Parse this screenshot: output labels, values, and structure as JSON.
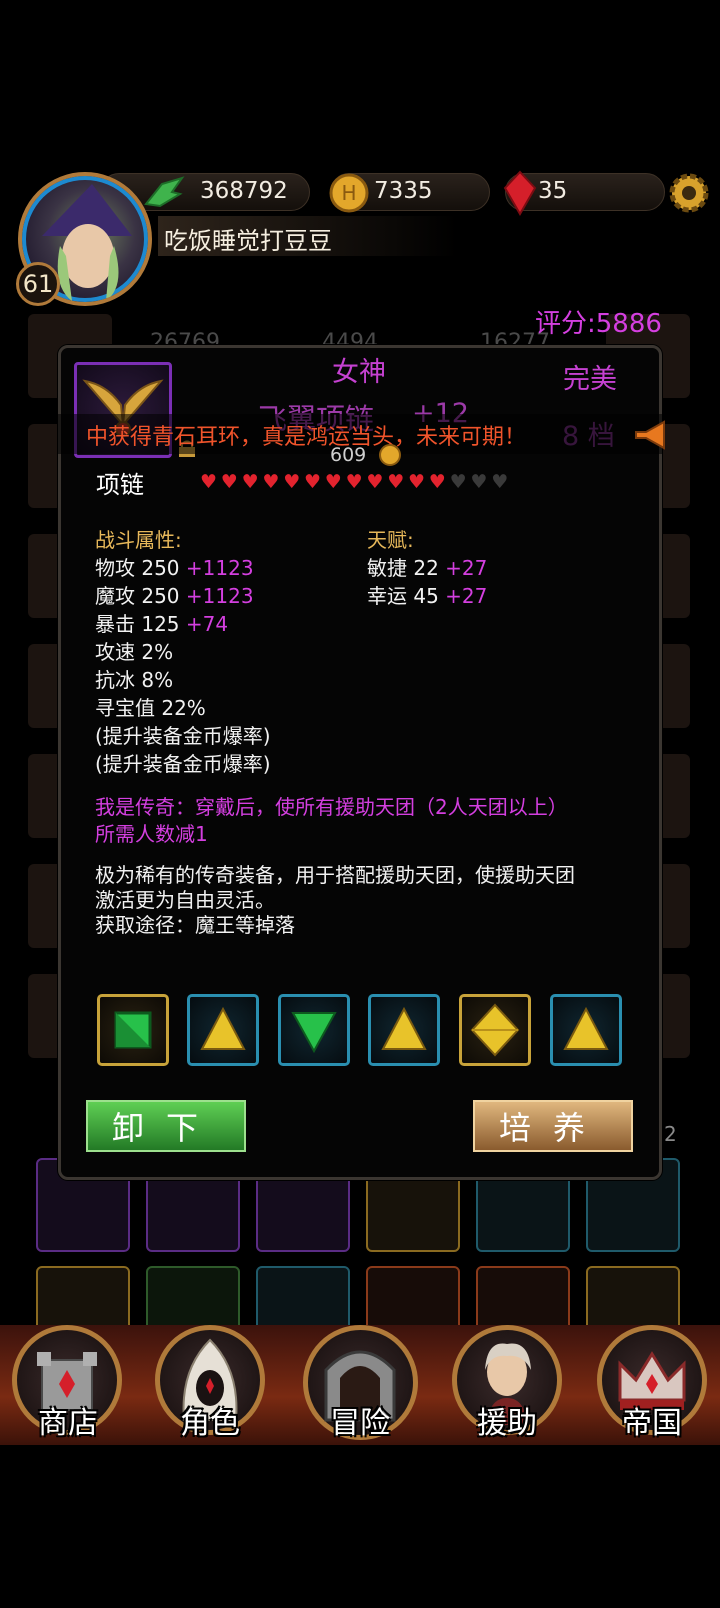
{
  "header": {
    "exp": "368792",
    "gold": "7335",
    "gems": "35",
    "level": "61",
    "player_name": "吃饭睡觉打豆豆",
    "score": "评分:5886"
  },
  "background_stats": {
    "s1": "26769",
    "s2": "4494",
    "s3": "16277",
    "page": "2"
  },
  "item": {
    "grade": "女神",
    "quality": "完美",
    "name": "飞翼项链",
    "enhance": "+12",
    "tier": "8 档",
    "price": "609",
    "type": "项链",
    "hearts_filled": 12,
    "hearts_total": 15
  },
  "broadcast": "中获得青石耳环，真是鸿运当头，未来可期！",
  "combat": {
    "heading": "战斗属性:",
    "rows": [
      {
        "label": "物攻 250",
        "bonus": "+1123"
      },
      {
        "label": "魔攻 250",
        "bonus": "+1123"
      },
      {
        "label": "暴击 125",
        "bonus": "+74"
      },
      {
        "label": "攻速 2%",
        "bonus": ""
      },
      {
        "label": "抗冰 8%",
        "bonus": ""
      },
      {
        "label": "寻宝值 22%",
        "bonus": ""
      },
      {
        "label": "(提升装备金币爆率)",
        "bonus": ""
      },
      {
        "label": "(提升装备金币爆率)",
        "bonus": ""
      }
    ]
  },
  "talent": {
    "heading": "天赋:",
    "rows": [
      {
        "label": "敏捷 22",
        "bonus": "+27"
      },
      {
        "label": "幸运 45",
        "bonus": "+27"
      }
    ]
  },
  "legend_text": [
    "我是传奇：穿戴后，使所有援助天团（2人天团以上）",
    "所需人数减1"
  ],
  "description": [
    "极为稀有的传奇装备，用于搭配援助天团，使援助天团",
    "激活更为自由灵活。",
    "获取途径：魔王等掉落"
  ],
  "gems": [
    {
      "icon": "green-square-gem-icon",
      "frame": "gold"
    },
    {
      "icon": "yellow-triangle-gem-icon",
      "frame": "blue"
    },
    {
      "icon": "green-triangle-gem-icon",
      "frame": "blue"
    },
    {
      "icon": "yellow-triangle-gem-icon",
      "frame": "blue"
    },
    {
      "icon": "yellow-diamond-gem-icon",
      "frame": "gold"
    },
    {
      "icon": "yellow-triangle-gem-icon",
      "frame": "blue"
    }
  ],
  "buttons": {
    "unequip": "卸下",
    "cultivate": "培养"
  },
  "nav": [
    {
      "label": "商店",
      "icon": "castle-icon"
    },
    {
      "label": "角色",
      "icon": "hooded-figure-icon"
    },
    {
      "label": "冒险",
      "icon": "dungeon-gate-icon"
    },
    {
      "label": "援助",
      "icon": "helper-portrait-icon"
    },
    {
      "label": "帝国",
      "icon": "crown-icon"
    }
  ],
  "colors": {
    "accent_purple": "#d43fe0",
    "gold_heading": "#e7b85a",
    "broadcast_red": "#f0542b",
    "heart_red": "#e3232e"
  }
}
